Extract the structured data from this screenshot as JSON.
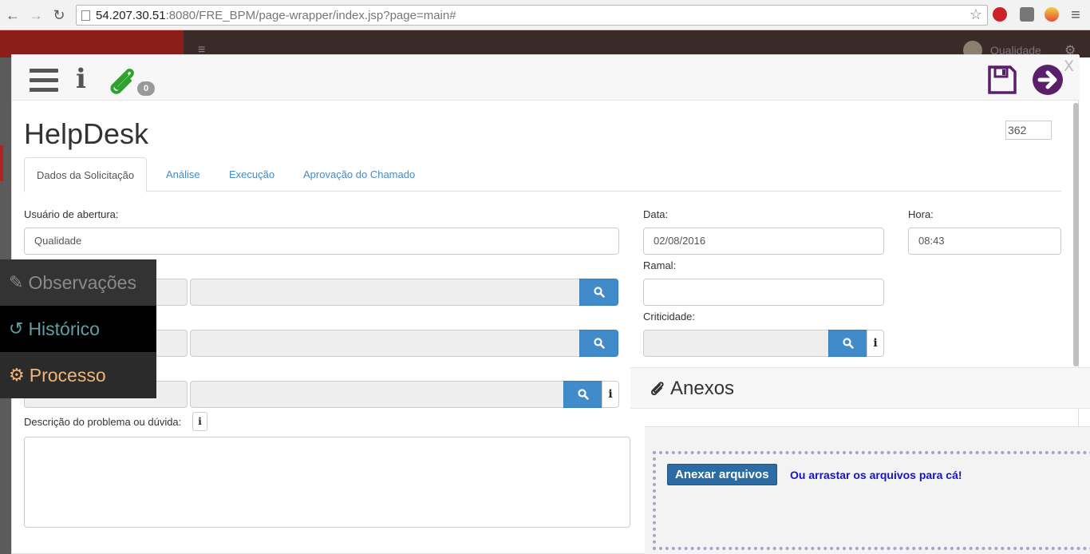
{
  "browser": {
    "url_host": "54.207.30.51",
    "url_path": ":8080/FRE_BPM/page-wrapper/index.jsp?page=main#"
  },
  "background": {
    "user_name": "Qualidade"
  },
  "toolbar": {
    "attachment_count": "0",
    "close_label": "X"
  },
  "form": {
    "title": "HelpDesk",
    "number": "362",
    "tabs": [
      {
        "label": "Dados da Solicitação",
        "active": true
      },
      {
        "label": "Análise",
        "active": false
      },
      {
        "label": "Execução",
        "active": false
      },
      {
        "label": "Aprovação do Chamado",
        "active": false
      }
    ],
    "fields": {
      "usuario_label": "Usuário de abertura:",
      "usuario_value": "Qualidade",
      "data_label": "Data:",
      "data_value": "02/08/2016",
      "hora_label": "Hora:",
      "hora_value": "08:43",
      "ramal_label": "Ramal:",
      "ramal_value": "",
      "criticidade_label": "Criticidade:",
      "descricao_label": "Descrição do problema ou dúvida:"
    }
  },
  "side_menu": {
    "items": [
      {
        "label": "Observações",
        "icon": "edit-icon"
      },
      {
        "label": "Histórico",
        "icon": "history-icon"
      },
      {
        "label": "Processo",
        "icon": "cogs-icon"
      }
    ]
  },
  "anexos": {
    "title": "Anexos",
    "attach_button": "Anexar arquivos",
    "drag_text": "Ou arrastar os arquivos para cá!"
  },
  "colors": {
    "primary": "#428bca",
    "next_button": "#5a1e6b",
    "save_icon": "#5a1e6b",
    "clip_icon": "#2fa12f",
    "drag_text": "#1515c8"
  }
}
